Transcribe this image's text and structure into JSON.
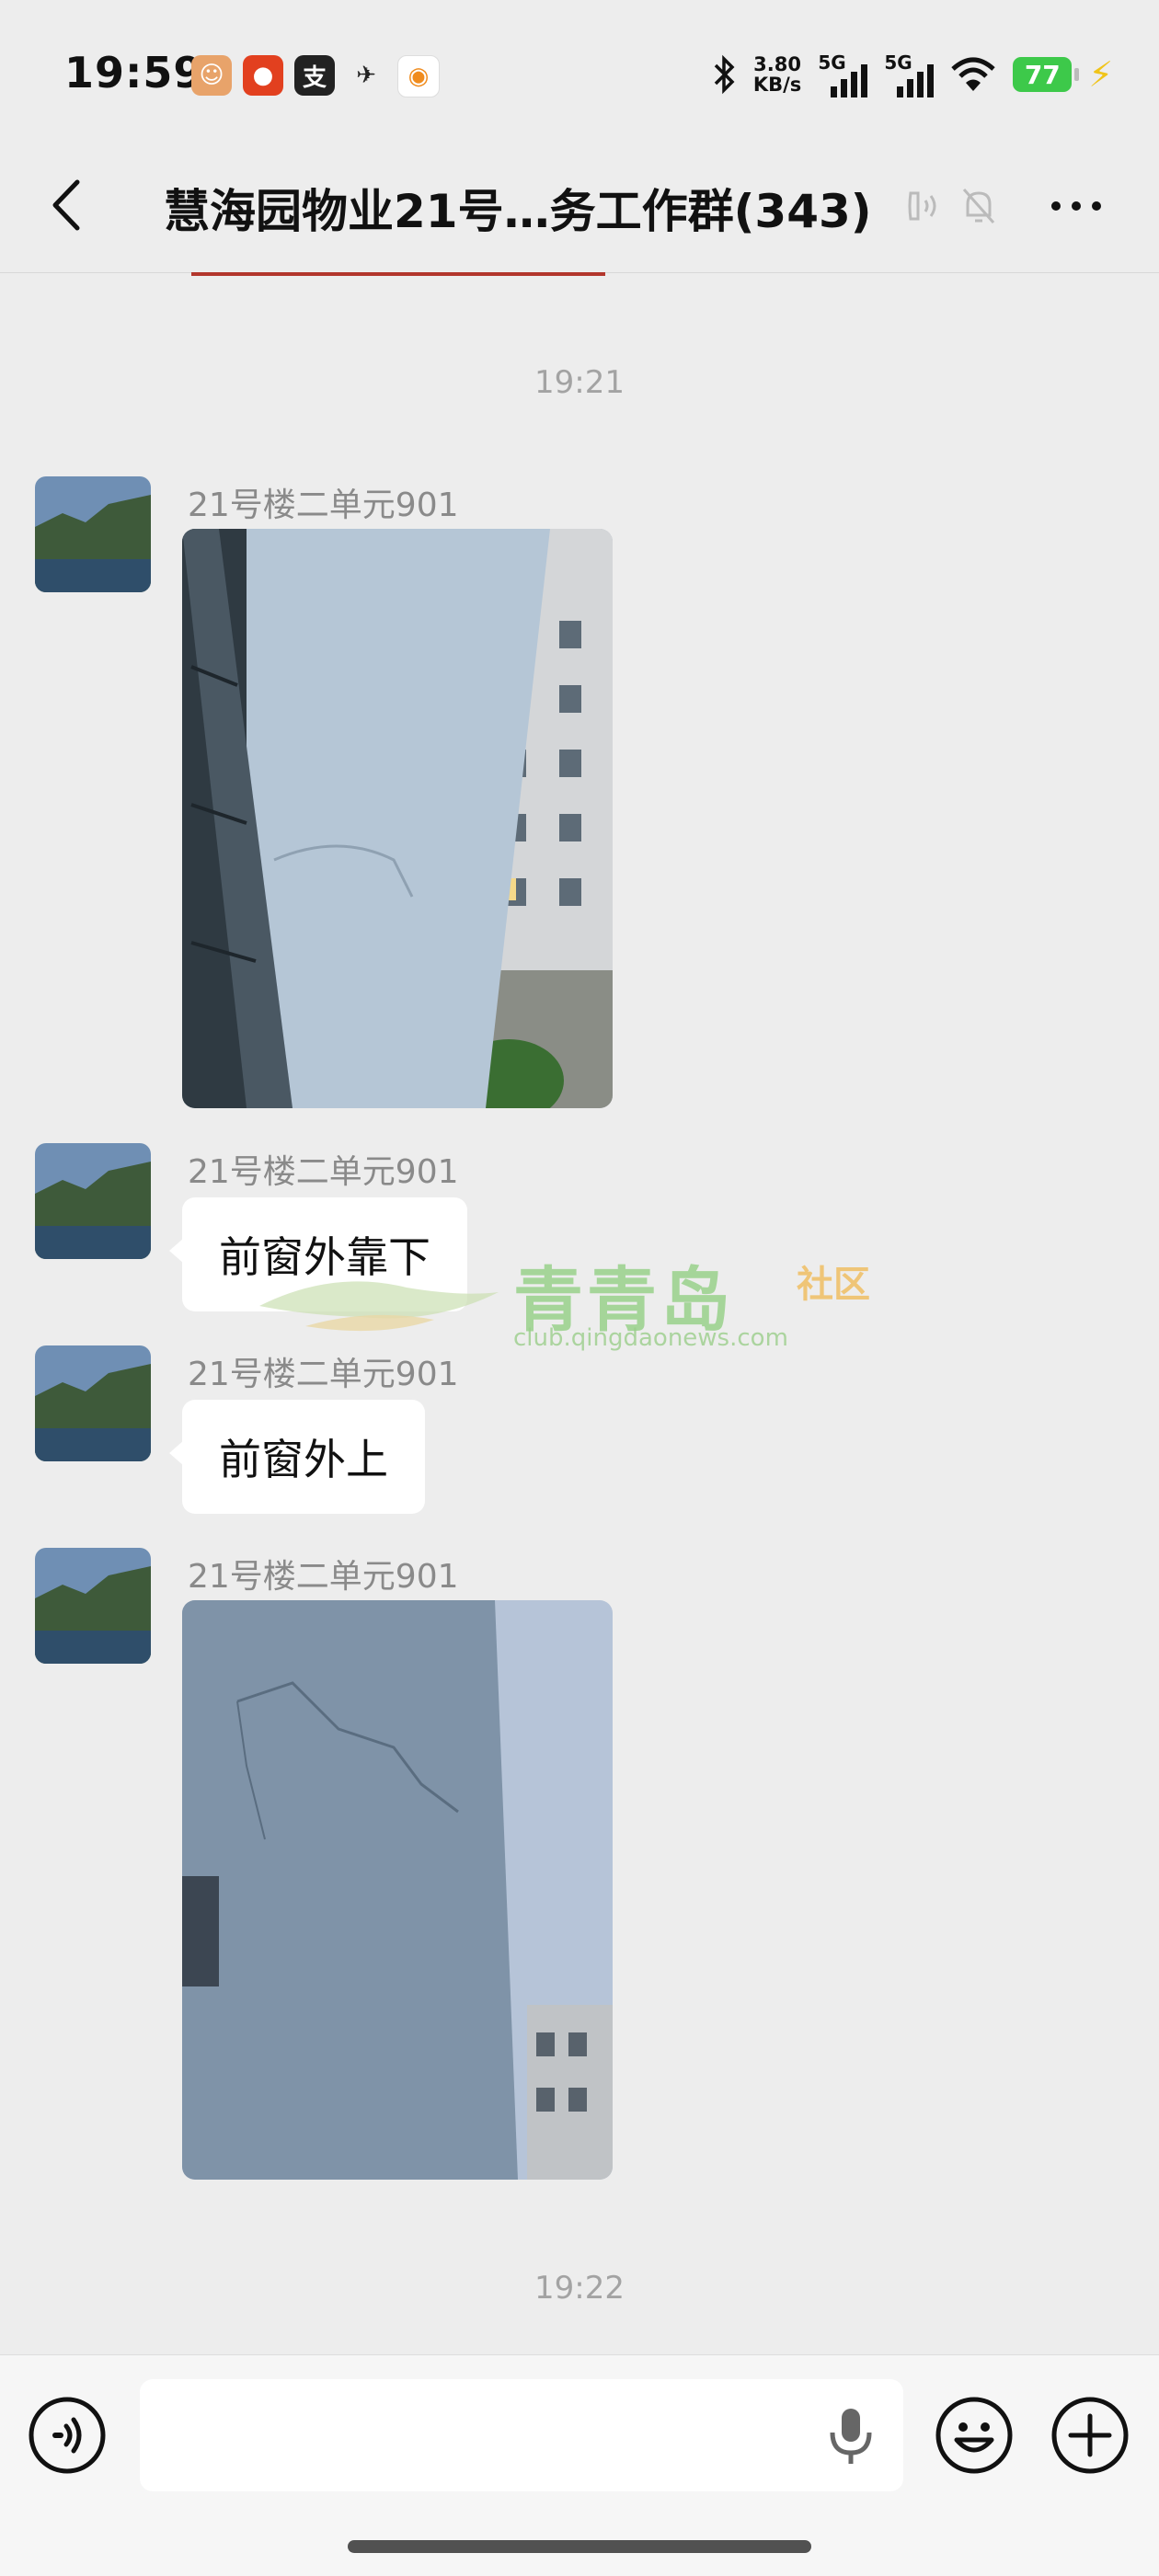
{
  "status_bar": {
    "time": "19:59",
    "net_speed_value": "3.80",
    "net_speed_unit": "KB/s",
    "signal1": "5G",
    "signal2": "5G",
    "battery": "77"
  },
  "header": {
    "title": "慧海园物业21号…务工作群(343)"
  },
  "messages": {
    "timestamp1": "19:21",
    "m1_sender": "21号楼二单元901",
    "m2_sender": "21号楼二单元901",
    "m2_text": "前窗外靠下",
    "m3_sender": "21号楼二单元901",
    "m3_text": "前窗外上",
    "m4_sender": "21号楼二单元901",
    "timestamp2": "19:22"
  },
  "watermark": {
    "name": "青青岛",
    "suffix": "社区",
    "url": "club.qingdaonews.com"
  },
  "colors": {
    "background": "#ededed",
    "accent_green": "#3dc94a",
    "watermark_green": "#7cc86a",
    "watermark_orange": "#f1b340"
  }
}
